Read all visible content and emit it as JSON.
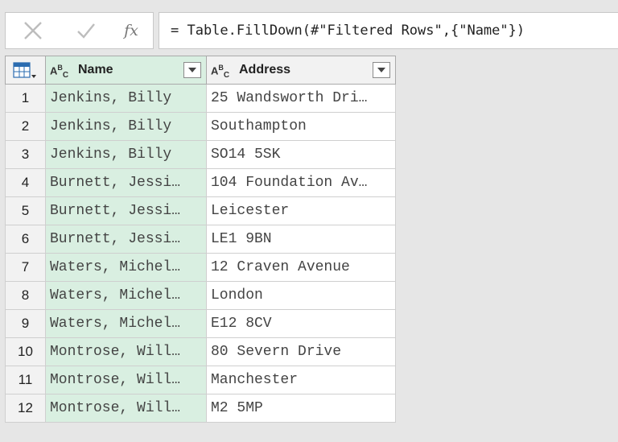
{
  "formula": {
    "fx_label": "fx",
    "text": "= Table.FillDown(#\"Filtered Rows\",{\"Name\"})"
  },
  "table": {
    "columns": [
      {
        "type_badge": "ABC",
        "label": "Name"
      },
      {
        "type_badge": "ABC",
        "label": "Address"
      }
    ],
    "rows": [
      {
        "n": "1",
        "name": "Jenkins, Billy",
        "address": "25 Wandsworth Dri…"
      },
      {
        "n": "2",
        "name": "Jenkins, Billy",
        "address": "Southampton"
      },
      {
        "n": "3",
        "name": "Jenkins, Billy",
        "address": "SO14 5SK"
      },
      {
        "n": "4",
        "name": "Burnett, Jessi…",
        "address": "104 Foundation Av…"
      },
      {
        "n": "5",
        "name": "Burnett, Jessi…",
        "address": "Leicester"
      },
      {
        "n": "6",
        "name": "Burnett, Jessi…",
        "address": "LE1 9BN"
      },
      {
        "n": "7",
        "name": "Waters, Michel…",
        "address": "12 Craven Avenue"
      },
      {
        "n": "8",
        "name": "Waters, Michel…",
        "address": "London"
      },
      {
        "n": "9",
        "name": "Waters, Michel…",
        "address": "E12 8CV"
      },
      {
        "n": "10",
        "name": "Montrose, Will…",
        "address": "80 Severn Drive"
      },
      {
        "n": "11",
        "name": "Montrose, Will…",
        "address": "Manchester"
      },
      {
        "n": "12",
        "name": "Montrose, Will…",
        "address": "M2 5MP"
      }
    ]
  },
  "colors": {
    "selected_column": "#d9efe1",
    "header": "#f2f2f2",
    "background": "#e6e6e6"
  },
  "icons": {
    "cancel": "close-icon",
    "commit": "checkmark-icon",
    "table_menu": "table-icon",
    "dropdown": "chevron-down-icon"
  }
}
